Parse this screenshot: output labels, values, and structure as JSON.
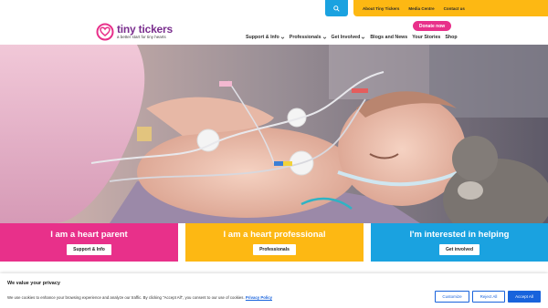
{
  "header": {
    "topbar_links": [
      "About Tiny Tickers",
      "Media Centre",
      "Contact us"
    ],
    "logo_name": "tiny tickers",
    "logo_tagline": "a better start for tiny hearts",
    "donate_label": "Donate now",
    "nav": [
      {
        "label": "Support & Info",
        "dropdown": true
      },
      {
        "label": "Professionals",
        "dropdown": true
      },
      {
        "label": "Get Involved",
        "dropdown": true
      },
      {
        "label": "Blogs and News",
        "dropdown": false
      },
      {
        "label": "Your Stories",
        "dropdown": false
      },
      {
        "label": "Shop",
        "dropdown": false
      }
    ]
  },
  "cards": [
    {
      "title": "I am a heart parent",
      "button": "Support & Info",
      "color": "#e8308a"
    },
    {
      "title": "I am a heart professional",
      "button": "Professionals",
      "color": "#fdb813"
    },
    {
      "title": "I'm interested in helping",
      "button": "Get involved",
      "color": "#1aa2e0"
    }
  ],
  "cookie": {
    "title": "We value your privacy",
    "text": "We use cookies to enhance your browsing experience and analyze our traffic. By clicking \"Accept All\", you consent to our use of cookies.",
    "policy_link": "Privacy Policy",
    "customize": "Customize",
    "reject": "Reject All",
    "accept": "Accept All"
  },
  "colors": {
    "pink": "#e8308a",
    "yellow": "#fdb813",
    "blue": "#1aa2e0",
    "purple": "#7a2e8e",
    "cookie_blue": "#1863dc"
  }
}
